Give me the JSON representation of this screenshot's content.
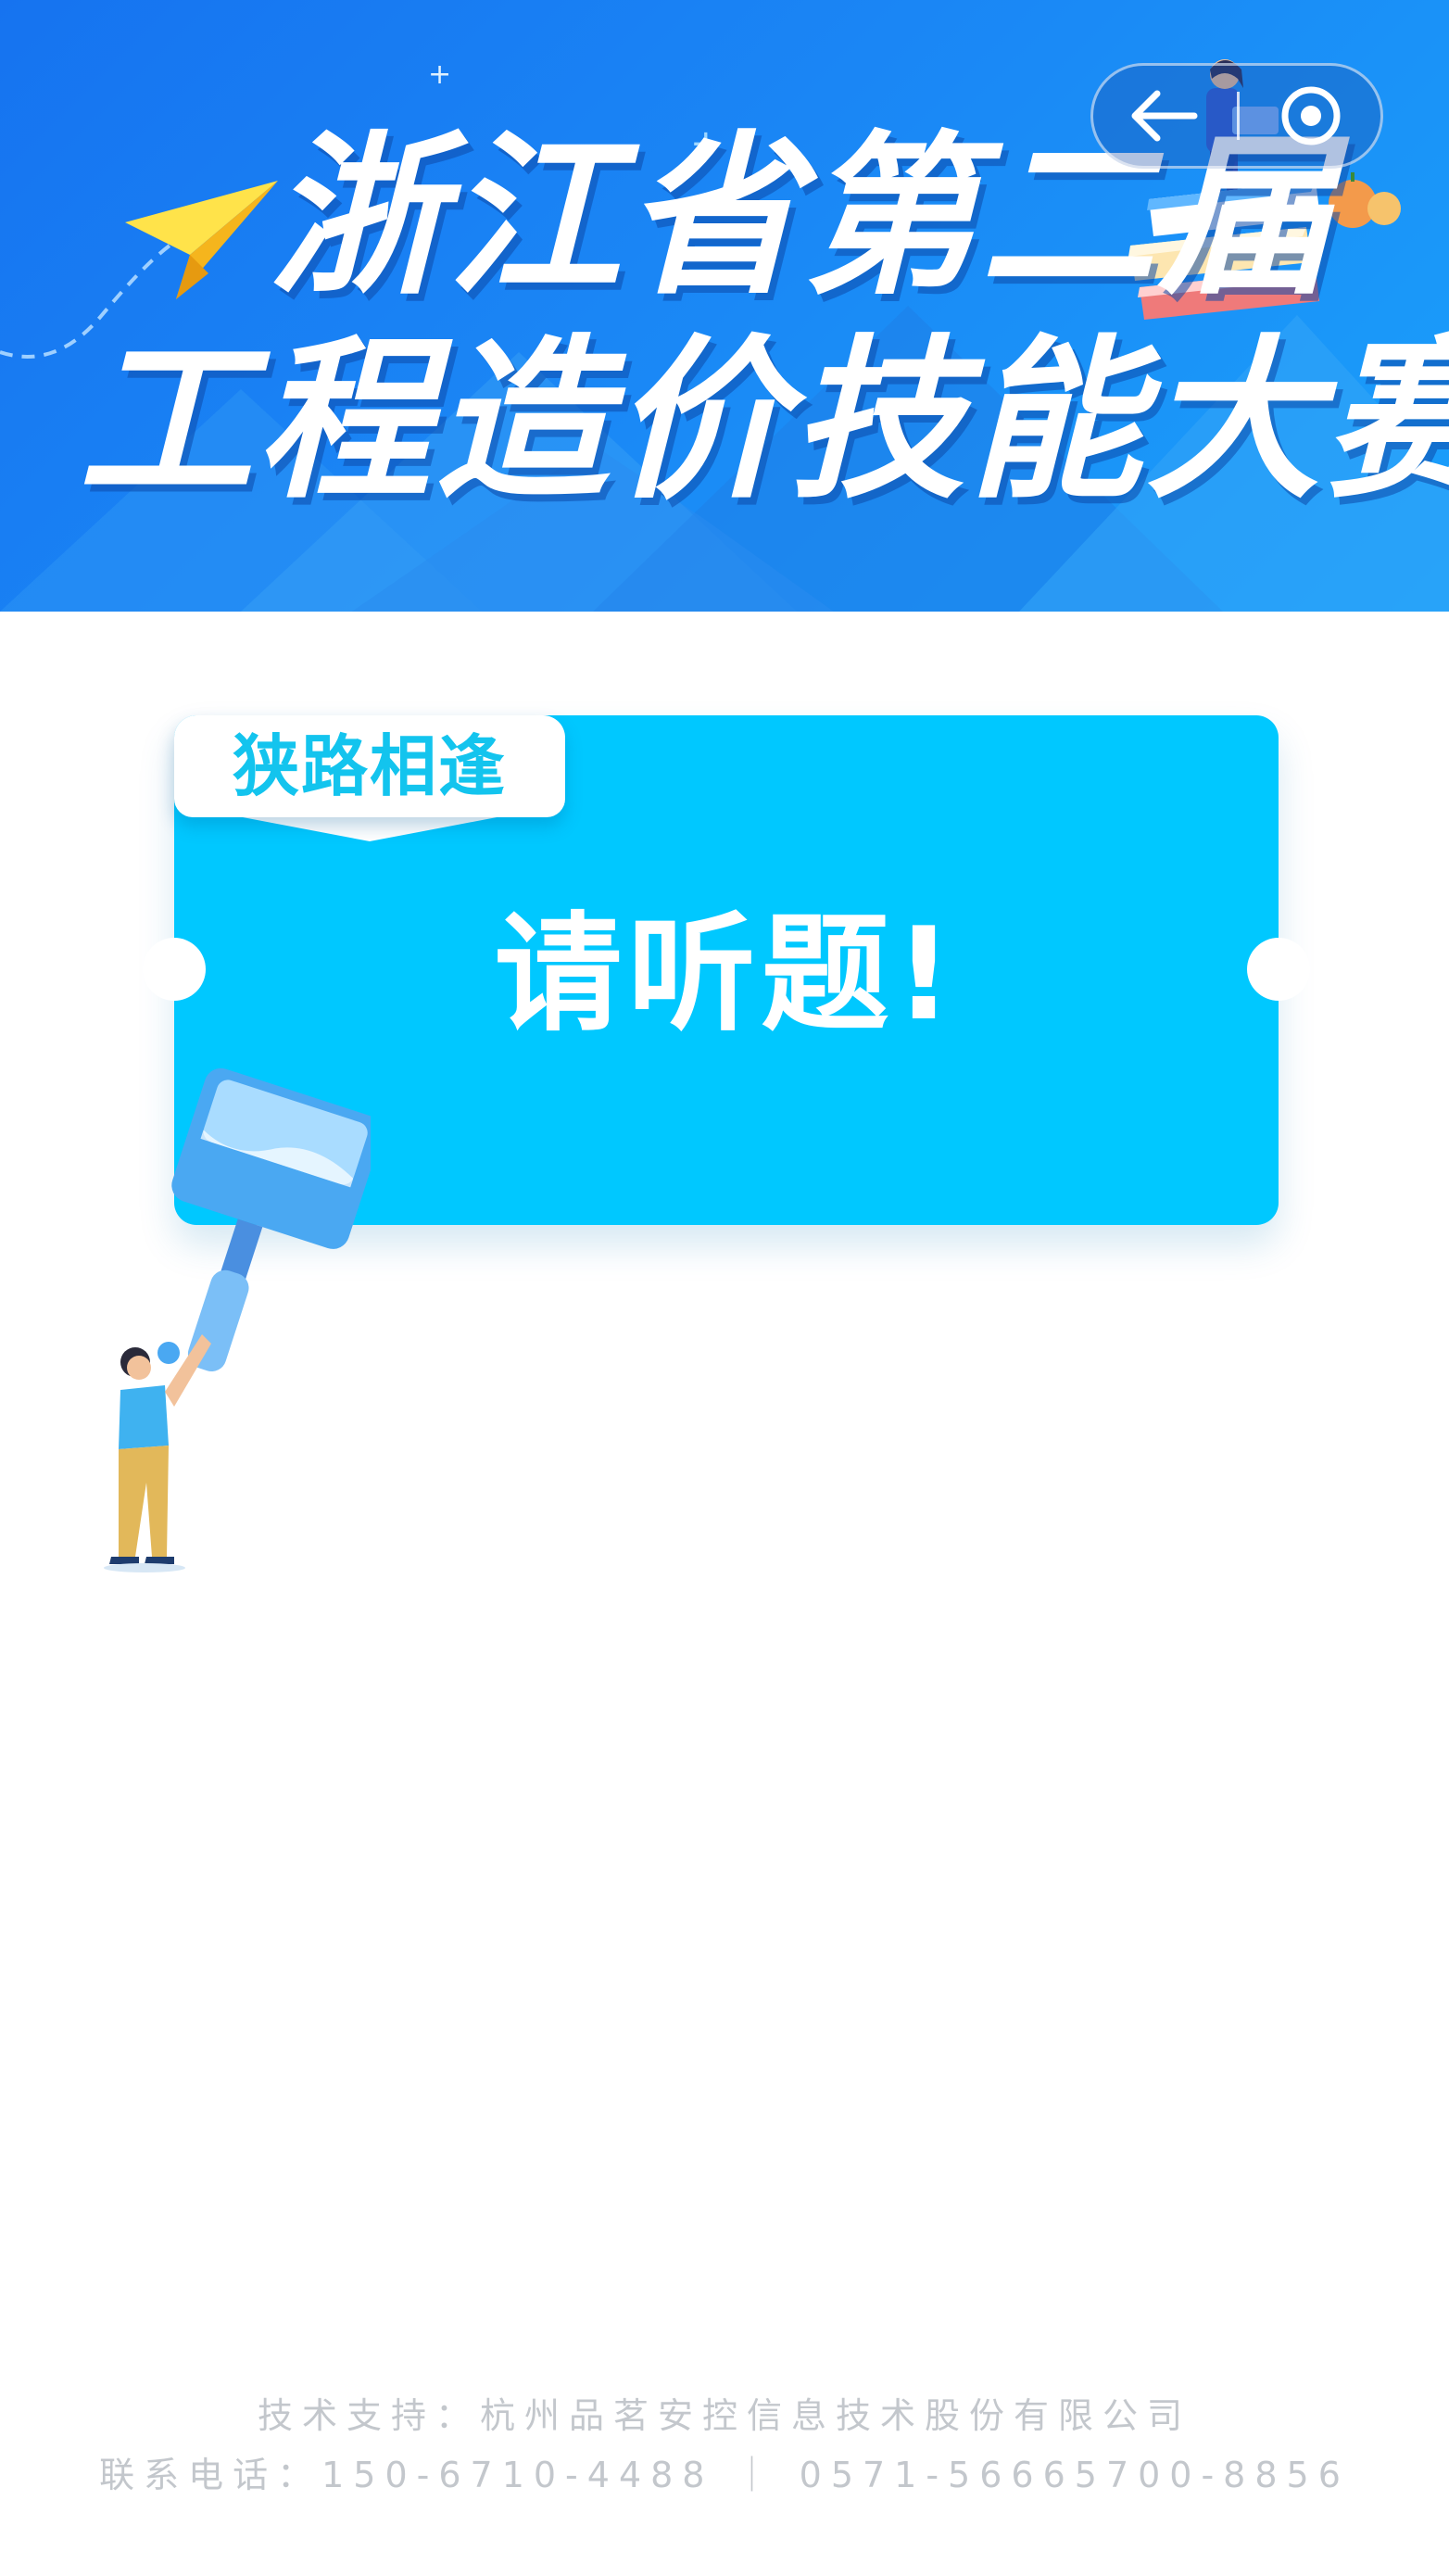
{
  "banner": {
    "title_line_1": "浙江省第二届",
    "title_line_2": "工程造价技能大赛"
  },
  "nav": {
    "back_icon": "arrow-left-icon",
    "target_icon": "target-icon"
  },
  "card": {
    "tag_label": "狭路相逢",
    "question_text": "请听题!"
  },
  "colors": {
    "banner_blue": "#1a86f5",
    "card_cyan": "#00c8ff",
    "tag_text": "#13c4ee",
    "footer_text": "#c3c7cc"
  },
  "footer": {
    "support_text": "技术支持：杭州品茗安控信息技术股份有限公司",
    "contact_text": "联系电话：150-6710-4488 ｜ 0571-56665700-8856"
  }
}
